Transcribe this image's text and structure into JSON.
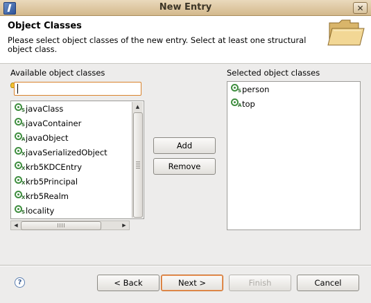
{
  "window": {
    "title": "New Entry",
    "close_glyph": "✕"
  },
  "banner": {
    "title": "Object Classes",
    "description": "Please select object classes of the new entry. Select at least one structural object class.",
    "icon": "folder-icon"
  },
  "available": {
    "label": "Available object classes",
    "filter_value": "",
    "items": [
      {
        "label": "javaClass",
        "badge": "S"
      },
      {
        "label": "javaContainer",
        "badge": "S"
      },
      {
        "label": "javaObject",
        "badge": "A"
      },
      {
        "label": "javaSerializedObject",
        "badge": "X"
      },
      {
        "label": "krb5KDCEntry",
        "badge": "X"
      },
      {
        "label": "krb5Principal",
        "badge": "X"
      },
      {
        "label": "krb5Realm",
        "badge": "X"
      },
      {
        "label": "locality",
        "badge": "S"
      }
    ]
  },
  "actions": {
    "add_label": "Add",
    "remove_label": "Remove"
  },
  "selected": {
    "label": "Selected object classes",
    "items": [
      {
        "label": "person",
        "badge": "S"
      },
      {
        "label": "top",
        "badge": "A"
      }
    ]
  },
  "footer": {
    "help_glyph": "?",
    "back_label": "< Back",
    "next_label": "Next >",
    "finish_label": "Finish",
    "cancel_label": "Cancel"
  },
  "colors": {
    "titlebar": "#D8C29A",
    "accent_focus": "#D9822B",
    "object_class_icon": "#3F8E3F"
  }
}
